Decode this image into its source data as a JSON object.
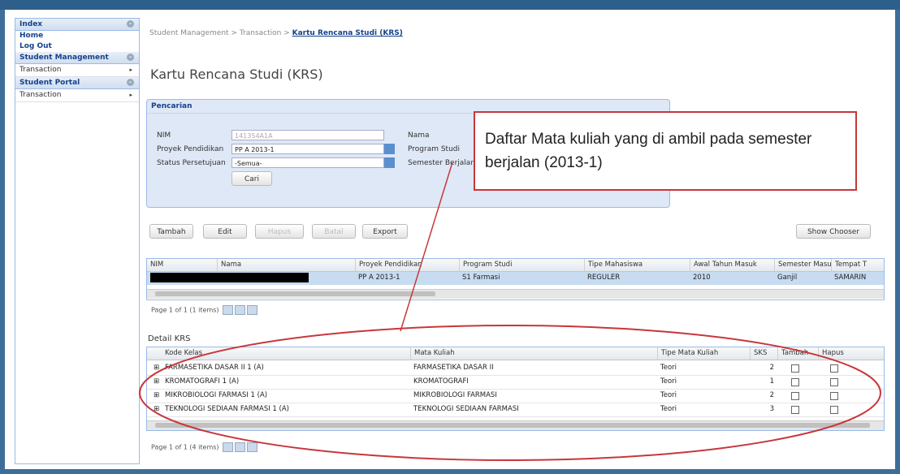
{
  "sidebar": {
    "index_label": "Index",
    "links": [
      "Home",
      "Log Out"
    ],
    "sections": [
      {
        "label": "Student Management",
        "items": [
          "Transaction"
        ]
      },
      {
        "label": "Student Portal",
        "items": [
          "Transaction"
        ]
      }
    ]
  },
  "breadcrumb": {
    "part1": "Student Management",
    "sep": " > ",
    "part2": "Transaction",
    "current": "Kartu Rencana Studi (KRS)"
  },
  "page_title": "Kartu Rencana Studi (KRS)",
  "search": {
    "title": "Pencarian",
    "nim_label": "NIM",
    "nim_value": "1413S4A1A",
    "proyek_label": "Proyek Pendidikan",
    "proyek_value": "PP A 2013-1",
    "status_label": "Status Persetujuan",
    "status_value": "-Semua-",
    "cari_label": "Cari",
    "nama_label": "Nama",
    "prodi_label": "Program Studi",
    "semester_label": "Semester Berjalan"
  },
  "toolbar": {
    "tambah": "Tambah",
    "edit": "Edit",
    "hapus": "Hapus",
    "batal": "Batal",
    "export": "Export",
    "show_chooser": "Show Chooser"
  },
  "main_grid": {
    "columns": [
      "NIM",
      "Nama",
      "Proyek Pendidikan",
      "Program Studi",
      "Tipe Mahasiswa",
      "Awal Tahun Masuk",
      "Semester Masuk",
      "Tempat T"
    ],
    "row": [
      "",
      "",
      "PP A 2013-1",
      "S1 Farmasi",
      "REGULER",
      "2010",
      "Ganjil",
      "SAMARIN"
    ],
    "pager": "Page 1 of 1 (1 items)"
  },
  "detail": {
    "title": "Detail KRS",
    "columns": [
      "Kode Kelas",
      "Mata Kuliah",
      "Tipe Mata Kuliah",
      "SKS",
      "Tambah",
      "Hapus"
    ],
    "rows": [
      {
        "kode": "FARMASETIKA DASAR II 1 (A)",
        "mk": "FARMASETIKA DASAR II",
        "tipe": "Teori",
        "sks": "2"
      },
      {
        "kode": "KROMATOGRAFI 1 (A)",
        "mk": "KROMATOGRAFI",
        "tipe": "Teori",
        "sks": "1"
      },
      {
        "kode": "MIKROBIOLOGI FARMASI 1 (A)",
        "mk": "MIKROBIOLOGI FARMASI",
        "tipe": "Teori",
        "sks": "2"
      },
      {
        "kode": "TEKNOLOGI SEDIAAN FARMASI 1 (A)",
        "mk": "TEKNOLOGI SEDIAAN FARMASI",
        "tipe": "Teori",
        "sks": "3"
      }
    ],
    "pager": "Page 1 of 1 (4 items)"
  },
  "callout": "Daftar Mata kuliah yang di ambil pada semester berjalan (2013-1)",
  "colors": {
    "annotation": "#c8363a",
    "header_blue": "#15428b",
    "selected_row": "#c7dcf1"
  }
}
